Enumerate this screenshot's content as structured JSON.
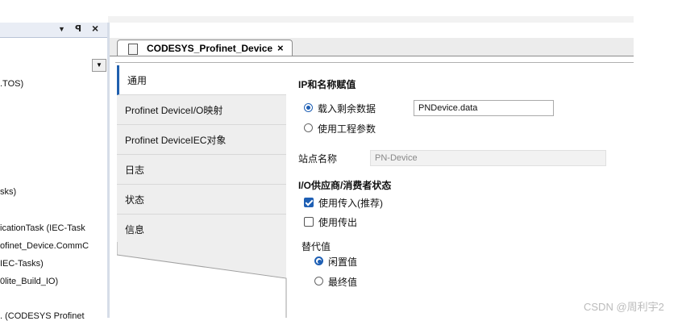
{
  "left_panel": {
    "toolbar": {
      "dropdown_icon": "▼",
      "pin_icon": "ᵶ",
      "close_icon": "×"
    },
    "tree_items": [
      ".TOS)",
      "sks)",
      "icationTask (IEC-Task",
      "ofinet_Device.CommC",
      "IEC-Tasks)",
      "0lite_Build_IO)",
      ". (CODESYS Profinet"
    ]
  },
  "editor": {
    "tab_title": "CODESYS_Profinet_Device",
    "tab_close": "×"
  },
  "vertical_tabs": [
    {
      "label": "通用",
      "active": true
    },
    {
      "label": "Profinet DeviceI/O映射",
      "active": false
    },
    {
      "label": "Profinet DeviceIEC对象",
      "active": false
    },
    {
      "label": "日志",
      "active": false
    },
    {
      "label": "状态",
      "active": false
    },
    {
      "label": "信息",
      "active": false
    }
  ],
  "settings": {
    "ip_section_title": "IP和名称赋值",
    "radio_load_remanent": "载入剩余数据",
    "remanent_file_value": "PNDevice.data",
    "radio_use_project_params": "使用工程参数",
    "station_name_label": "站点名称",
    "station_name_value": "PN-Device",
    "io_section_title": "I/O供应商/消费者状态",
    "checkbox_use_incoming": "使用传入(推荐)",
    "checkbox_use_outgoing": "使用传出",
    "substitute_title": "替代值",
    "radio_idle_value": "闲置值",
    "radio_last_value": "最终值"
  },
  "watermark": "CSDN @周利宇2",
  "colors": {
    "accent": "#1e5fb4",
    "tab_bg": "#eeeeee"
  }
}
